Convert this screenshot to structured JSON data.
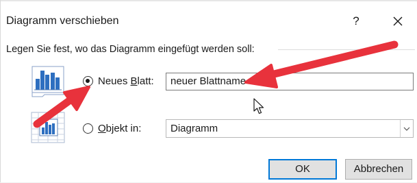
{
  "dialog": {
    "title": "Diagramm verschieben",
    "help_label": "?",
    "close_icon": "close-icon"
  },
  "prompt": "Legen Sie fest, wo das Diagramm eingefügt werden soll:",
  "options": {
    "new_sheet": {
      "icon": "new-sheet-chart-icon",
      "label_pre": "Neues ",
      "label_accel": "B",
      "label_post": "latt:",
      "selected": true,
      "value": "neuer Blattname"
    },
    "object_in": {
      "icon": "embedded-chart-icon",
      "label_pre": "",
      "label_accel": "O",
      "label_post": "bjekt in:",
      "selected": false,
      "value": "Diagramm"
    }
  },
  "buttons": {
    "ok": "OK",
    "cancel": "Abbrechen"
  },
  "colors": {
    "accent": "#0078d7",
    "annotation_arrow": "#e8323c",
    "icon_blue": "#2e6fc0"
  }
}
